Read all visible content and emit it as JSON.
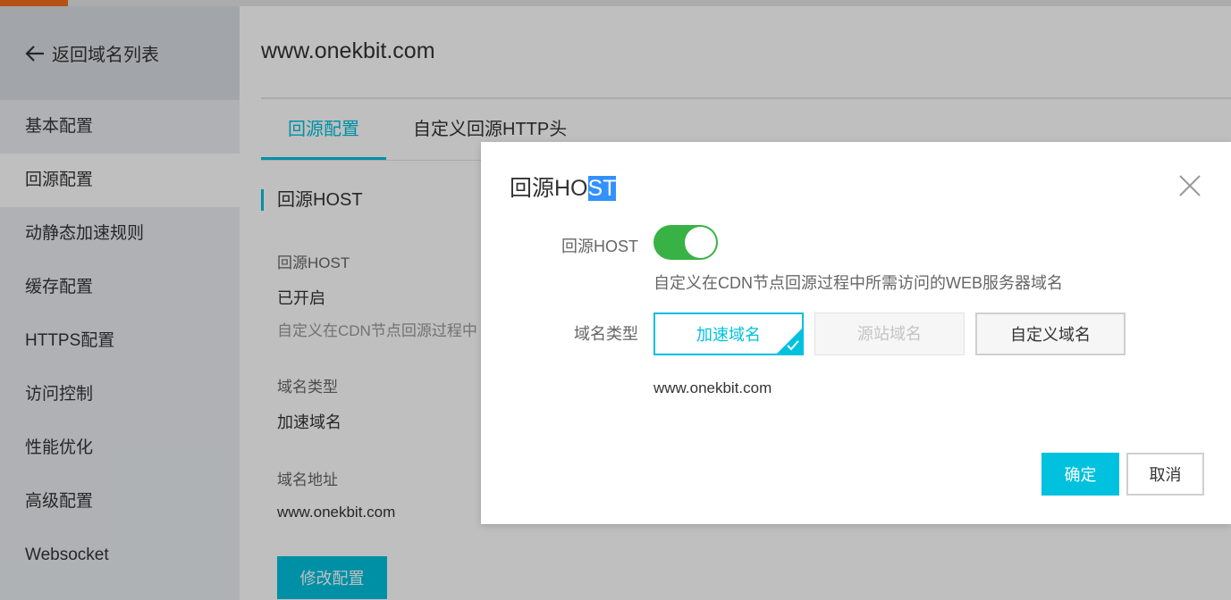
{
  "sidebar": {
    "back_label": "返回域名列表",
    "items": [
      {
        "label": "基本配置"
      },
      {
        "label": "回源配置"
      },
      {
        "label": "动静态加速规则"
      },
      {
        "label": "缓存配置"
      },
      {
        "label": "HTTPS配置"
      },
      {
        "label": "访问控制"
      },
      {
        "label": "性能优化"
      },
      {
        "label": "高级配置"
      },
      {
        "label": "Websocket"
      }
    ],
    "active_item": "回源配置"
  },
  "main": {
    "domain_title": "www.onekbit.com",
    "tabs": [
      {
        "label": "回源配置",
        "active": true
      },
      {
        "label": "自定义回源HTTP头",
        "active": false
      }
    ],
    "section_title": "回源HOST",
    "host_label": "回源HOST",
    "host_status": "已开启",
    "host_desc": "自定义在CDN节点回源过程中",
    "type_label": "域名类型",
    "type_value": "加速域名",
    "addr_label": "域名地址",
    "addr_value": "www.onekbit.com",
    "edit_button": "修改配置"
  },
  "modal": {
    "title_prefix": "回源HO",
    "title_selected": "ST",
    "host_label": "回源HOST",
    "switch_on": true,
    "description": "自定义在CDN节点回源过程中所需访问的WEB服务器域名",
    "type_label": "域名类型",
    "options": [
      {
        "label": "加速域名",
        "state": "selected"
      },
      {
        "label": "源站域名",
        "state": "disabled"
      },
      {
        "label": "自定义域名",
        "state": "normal"
      }
    ],
    "domain_value": "www.onekbit.com",
    "confirm_button": "确定",
    "cancel_button": "取消"
  },
  "colors": {
    "accent": "#00c1de",
    "toggle_on": "#38b245",
    "top_accent": "#f36c1c",
    "text_selection": "#3390ff"
  },
  "icons": [
    "arrow-left-icon",
    "close-icon",
    "check-icon"
  ]
}
